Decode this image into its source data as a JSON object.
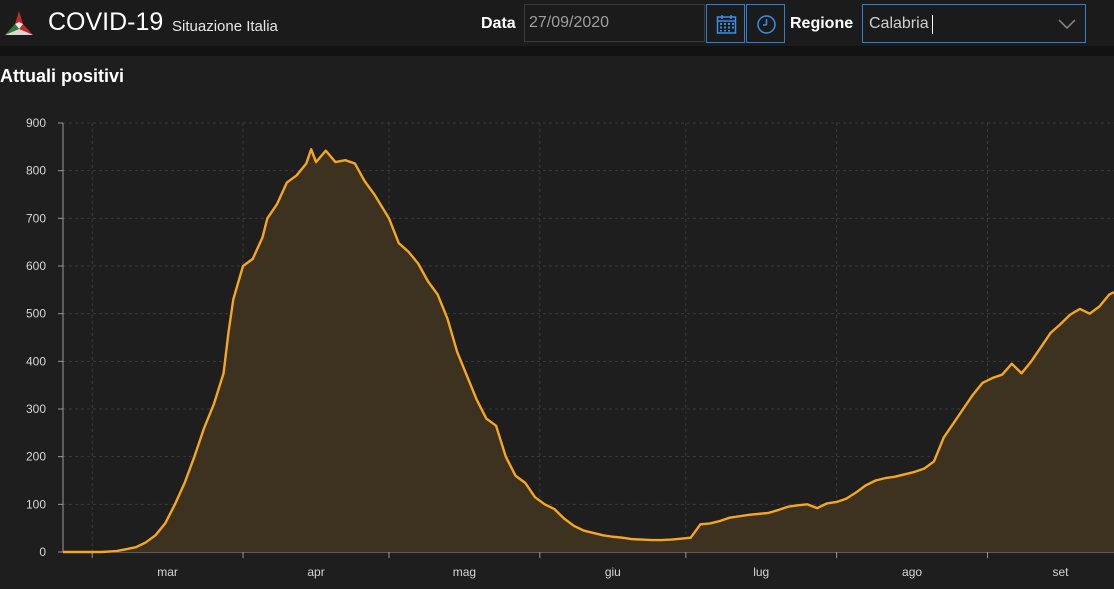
{
  "header": {
    "title": "COVID-19",
    "subtitle": "Situazione Italia",
    "date_label": "Data",
    "date_value": "27/09/2020",
    "region_label": "Regione",
    "region_value": "Calabria",
    "icons": {
      "logo": "italy-covid-logo",
      "calendar": "calendar-icon",
      "clock": "clock-icon",
      "dropdown": "chevron-down-icon"
    },
    "colors": {
      "accent": "#2f7fd6",
      "line": "#f5a623",
      "fill": "#3d3120"
    }
  },
  "chart_title": "Attuali positivi",
  "chart_data": {
    "type": "area",
    "title": "Attuali positivi",
    "xlabel": "",
    "ylabel": "",
    "ylim": [
      0,
      900
    ],
    "yticks": [
      0,
      100,
      200,
      300,
      400,
      500,
      600,
      700,
      800,
      900
    ],
    "xticks": [
      "mar",
      "apr",
      "mag",
      "giu",
      "lug",
      "ago",
      "set"
    ],
    "xticks_dates": [
      "2020-03-01",
      "2020-04-01",
      "2020-05-01",
      "2020-06-01",
      "2020-07-01",
      "2020-08-01",
      "2020-09-01"
    ],
    "grid": true,
    "series": [
      {
        "name": "",
        "color": "#f5a623",
        "points": [
          [
            "2020-02-24",
            0
          ],
          [
            "2020-02-28",
            0
          ],
          [
            "2020-03-03",
            0
          ],
          [
            "2020-03-06",
            2
          ],
          [
            "2020-03-08",
            6
          ],
          [
            "2020-03-10",
            10
          ],
          [
            "2020-03-12",
            20
          ],
          [
            "2020-03-14",
            35
          ],
          [
            "2020-03-16",
            60
          ],
          [
            "2020-03-18",
            100
          ],
          [
            "2020-03-20",
            145
          ],
          [
            "2020-03-22",
            200
          ],
          [
            "2020-03-24",
            260
          ],
          [
            "2020-03-26",
            310
          ],
          [
            "2020-03-28",
            375
          ],
          [
            "2020-03-29",
            460
          ],
          [
            "2020-03-30",
            530
          ],
          [
            "2020-04-01",
            600
          ],
          [
            "2020-04-03",
            615
          ],
          [
            "2020-04-05",
            660
          ],
          [
            "2020-04-06",
            700
          ],
          [
            "2020-04-08",
            730
          ],
          [
            "2020-04-10",
            775
          ],
          [
            "2020-04-12",
            790
          ],
          [
            "2020-04-14",
            815
          ],
          [
            "2020-04-15",
            845
          ],
          [
            "2020-04-16",
            818
          ],
          [
            "2020-04-18",
            842
          ],
          [
            "2020-04-20",
            818
          ],
          [
            "2020-04-22",
            822
          ],
          [
            "2020-04-24",
            815
          ],
          [
            "2020-04-26",
            778
          ],
          [
            "2020-04-28",
            750
          ],
          [
            "2020-05-01",
            700
          ],
          [
            "2020-05-03",
            648
          ],
          [
            "2020-05-05",
            630
          ],
          [
            "2020-05-07",
            605
          ],
          [
            "2020-05-09",
            568
          ],
          [
            "2020-05-11",
            540
          ],
          [
            "2020-05-13",
            490
          ],
          [
            "2020-05-15",
            420
          ],
          [
            "2020-05-17",
            370
          ],
          [
            "2020-05-19",
            320
          ],
          [
            "2020-05-21",
            280
          ],
          [
            "2020-05-23",
            265
          ],
          [
            "2020-05-25",
            200
          ],
          [
            "2020-05-27",
            160
          ],
          [
            "2020-05-29",
            145
          ],
          [
            "2020-05-31",
            115
          ],
          [
            "2020-06-02",
            100
          ],
          [
            "2020-06-04",
            90
          ],
          [
            "2020-06-06",
            70
          ],
          [
            "2020-06-08",
            55
          ],
          [
            "2020-06-10",
            45
          ],
          [
            "2020-06-12",
            40
          ],
          [
            "2020-06-14",
            35
          ],
          [
            "2020-06-16",
            32
          ],
          [
            "2020-06-18",
            30
          ],
          [
            "2020-06-20",
            27
          ],
          [
            "2020-06-22",
            26
          ],
          [
            "2020-06-24",
            25
          ],
          [
            "2020-06-26",
            25
          ],
          [
            "2020-06-28",
            26
          ],
          [
            "2020-06-30",
            28
          ],
          [
            "2020-07-02",
            30
          ],
          [
            "2020-07-04",
            58
          ],
          [
            "2020-07-06",
            60
          ],
          [
            "2020-07-08",
            65
          ],
          [
            "2020-07-10",
            72
          ],
          [
            "2020-07-12",
            75
          ],
          [
            "2020-07-14",
            78
          ],
          [
            "2020-07-16",
            80
          ],
          [
            "2020-07-18",
            82
          ],
          [
            "2020-07-20",
            88
          ],
          [
            "2020-07-22",
            95
          ],
          [
            "2020-07-24",
            98
          ],
          [
            "2020-07-26",
            100
          ],
          [
            "2020-07-28",
            92
          ],
          [
            "2020-07-30",
            102
          ],
          [
            "2020-08-01",
            105
          ],
          [
            "2020-08-03",
            112
          ],
          [
            "2020-08-05",
            125
          ],
          [
            "2020-08-07",
            140
          ],
          [
            "2020-08-09",
            150
          ],
          [
            "2020-08-11",
            155
          ],
          [
            "2020-08-13",
            158
          ],
          [
            "2020-08-15",
            163
          ],
          [
            "2020-08-17",
            168
          ],
          [
            "2020-08-19",
            175
          ],
          [
            "2020-08-21",
            190
          ],
          [
            "2020-08-23",
            240
          ],
          [
            "2020-08-25",
            270
          ],
          [
            "2020-08-27",
            300
          ],
          [
            "2020-08-29",
            330
          ],
          [
            "2020-08-31",
            355
          ],
          [
            "2020-09-02",
            365
          ],
          [
            "2020-09-04",
            372
          ],
          [
            "2020-09-06",
            395
          ],
          [
            "2020-09-08",
            375
          ],
          [
            "2020-09-10",
            400
          ],
          [
            "2020-09-12",
            430
          ],
          [
            "2020-09-14",
            460
          ],
          [
            "2020-09-16",
            478
          ],
          [
            "2020-09-18",
            498
          ],
          [
            "2020-09-20",
            510
          ],
          [
            "2020-09-22",
            500
          ],
          [
            "2020-09-24",
            515
          ],
          [
            "2020-09-26",
            540
          ],
          [
            "2020-09-27",
            545
          ]
        ]
      }
    ]
  }
}
